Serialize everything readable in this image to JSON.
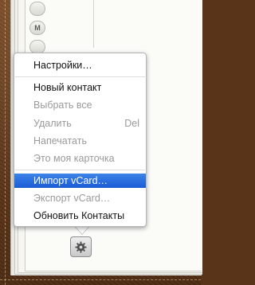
{
  "tabs": [
    {
      "label": ""
    },
    {
      "label": "М"
    },
    {
      "label": ""
    }
  ],
  "menu": {
    "settings": "Настройки…",
    "new_contact": "Новый контакт",
    "select_all": "Выбрать все",
    "delete": "Удалить",
    "delete_shortcut": "Del",
    "print": "Напечатать",
    "my_card": "Это моя карточка",
    "import_vcard": "Импорт vCard…",
    "export_vcard": "Экспорт vCard…",
    "refresh": "Обновить Контакты"
  },
  "icons": {
    "settings_button": "gear-icon"
  },
  "colors": {
    "selection": "#1a5bd6",
    "leather": "#60381a",
    "paper": "#fbfbf8"
  }
}
